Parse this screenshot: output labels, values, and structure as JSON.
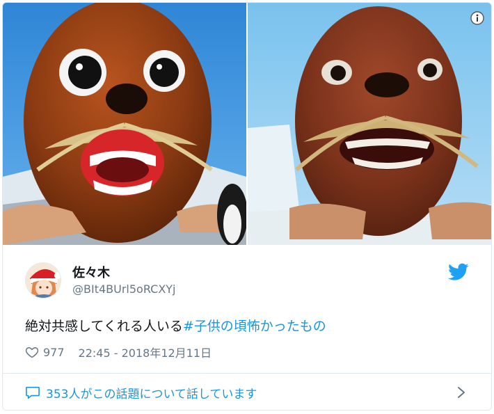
{
  "tweet": {
    "display_name": "佐々木",
    "screen_name": "@BIt4BUrl5oRCXYj",
    "text_plain": "絶対共感してくれる人いる",
    "hashtag": "#子供の頃怖かったもの",
    "like_count": "977",
    "timestamp": "22:45 - 2018年12月11日",
    "conversation_link": "353人がこの話題について話しています"
  },
  "icons": {
    "info": "info-icon",
    "twitter": "twitter-bird-icon",
    "like": "heart-icon",
    "reply": "speech-bubble-icon",
    "more": "chevron-right-icon"
  },
  "colors": {
    "link": "#1b95e0",
    "secondary_text": "#657786",
    "border": "#e1e8ed",
    "twitter_blue": "#1da1f2"
  }
}
